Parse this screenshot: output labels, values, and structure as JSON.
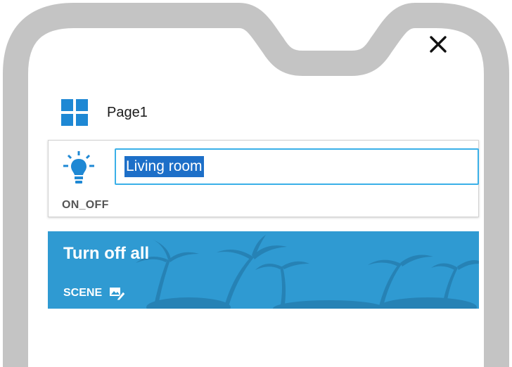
{
  "app": {
    "close_label": "close"
  },
  "page": {
    "name": "Page1",
    "icon": "grid-icon"
  },
  "device": {
    "icon": "lightbulb-icon",
    "name_value": "Living room",
    "type": "ON_OFF"
  },
  "scene": {
    "title": "Turn off all",
    "tag": "SCENE",
    "icon": "edit-scene-icon"
  },
  "colors": {
    "frame": "#c4c4c4",
    "accent": "#1e88d4",
    "input_border": "#3ab0e8",
    "selection": "#1d6fc8",
    "scene_bg": "#2f9ad2"
  }
}
